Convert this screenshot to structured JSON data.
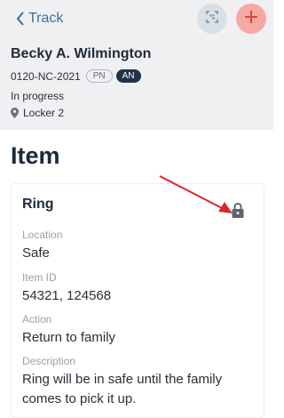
{
  "nav": {
    "back_label": "Track"
  },
  "icons": {
    "qr": "qr-scan-icon",
    "add": "plus-icon",
    "back": "chevron-left-icon",
    "location": "map-pin-icon",
    "lock": "lock-icon"
  },
  "person": {
    "name": "Becky A. Wilmington",
    "case_number": "0120-NC-2021",
    "tags": [
      "PN",
      "AN"
    ],
    "status": "In progress",
    "location": "Locker 2"
  },
  "section_title": "Item",
  "item": {
    "title": "Ring",
    "fields": [
      {
        "label": "Location",
        "value": "Safe"
      },
      {
        "label": "Item ID",
        "value": "54321, 124568"
      },
      {
        "label": "Action",
        "value": "Return to family"
      },
      {
        "label": "Description",
        "value": "Ring will be in safe until the family comes to pick it up."
      }
    ]
  },
  "colors": {
    "accent": "#3a6f9a",
    "add_button": "#f5a9a3",
    "qr_button": "#d8e0e6",
    "annotation_arrow": "#d9262c",
    "header_bg": "#f0f0f2"
  }
}
